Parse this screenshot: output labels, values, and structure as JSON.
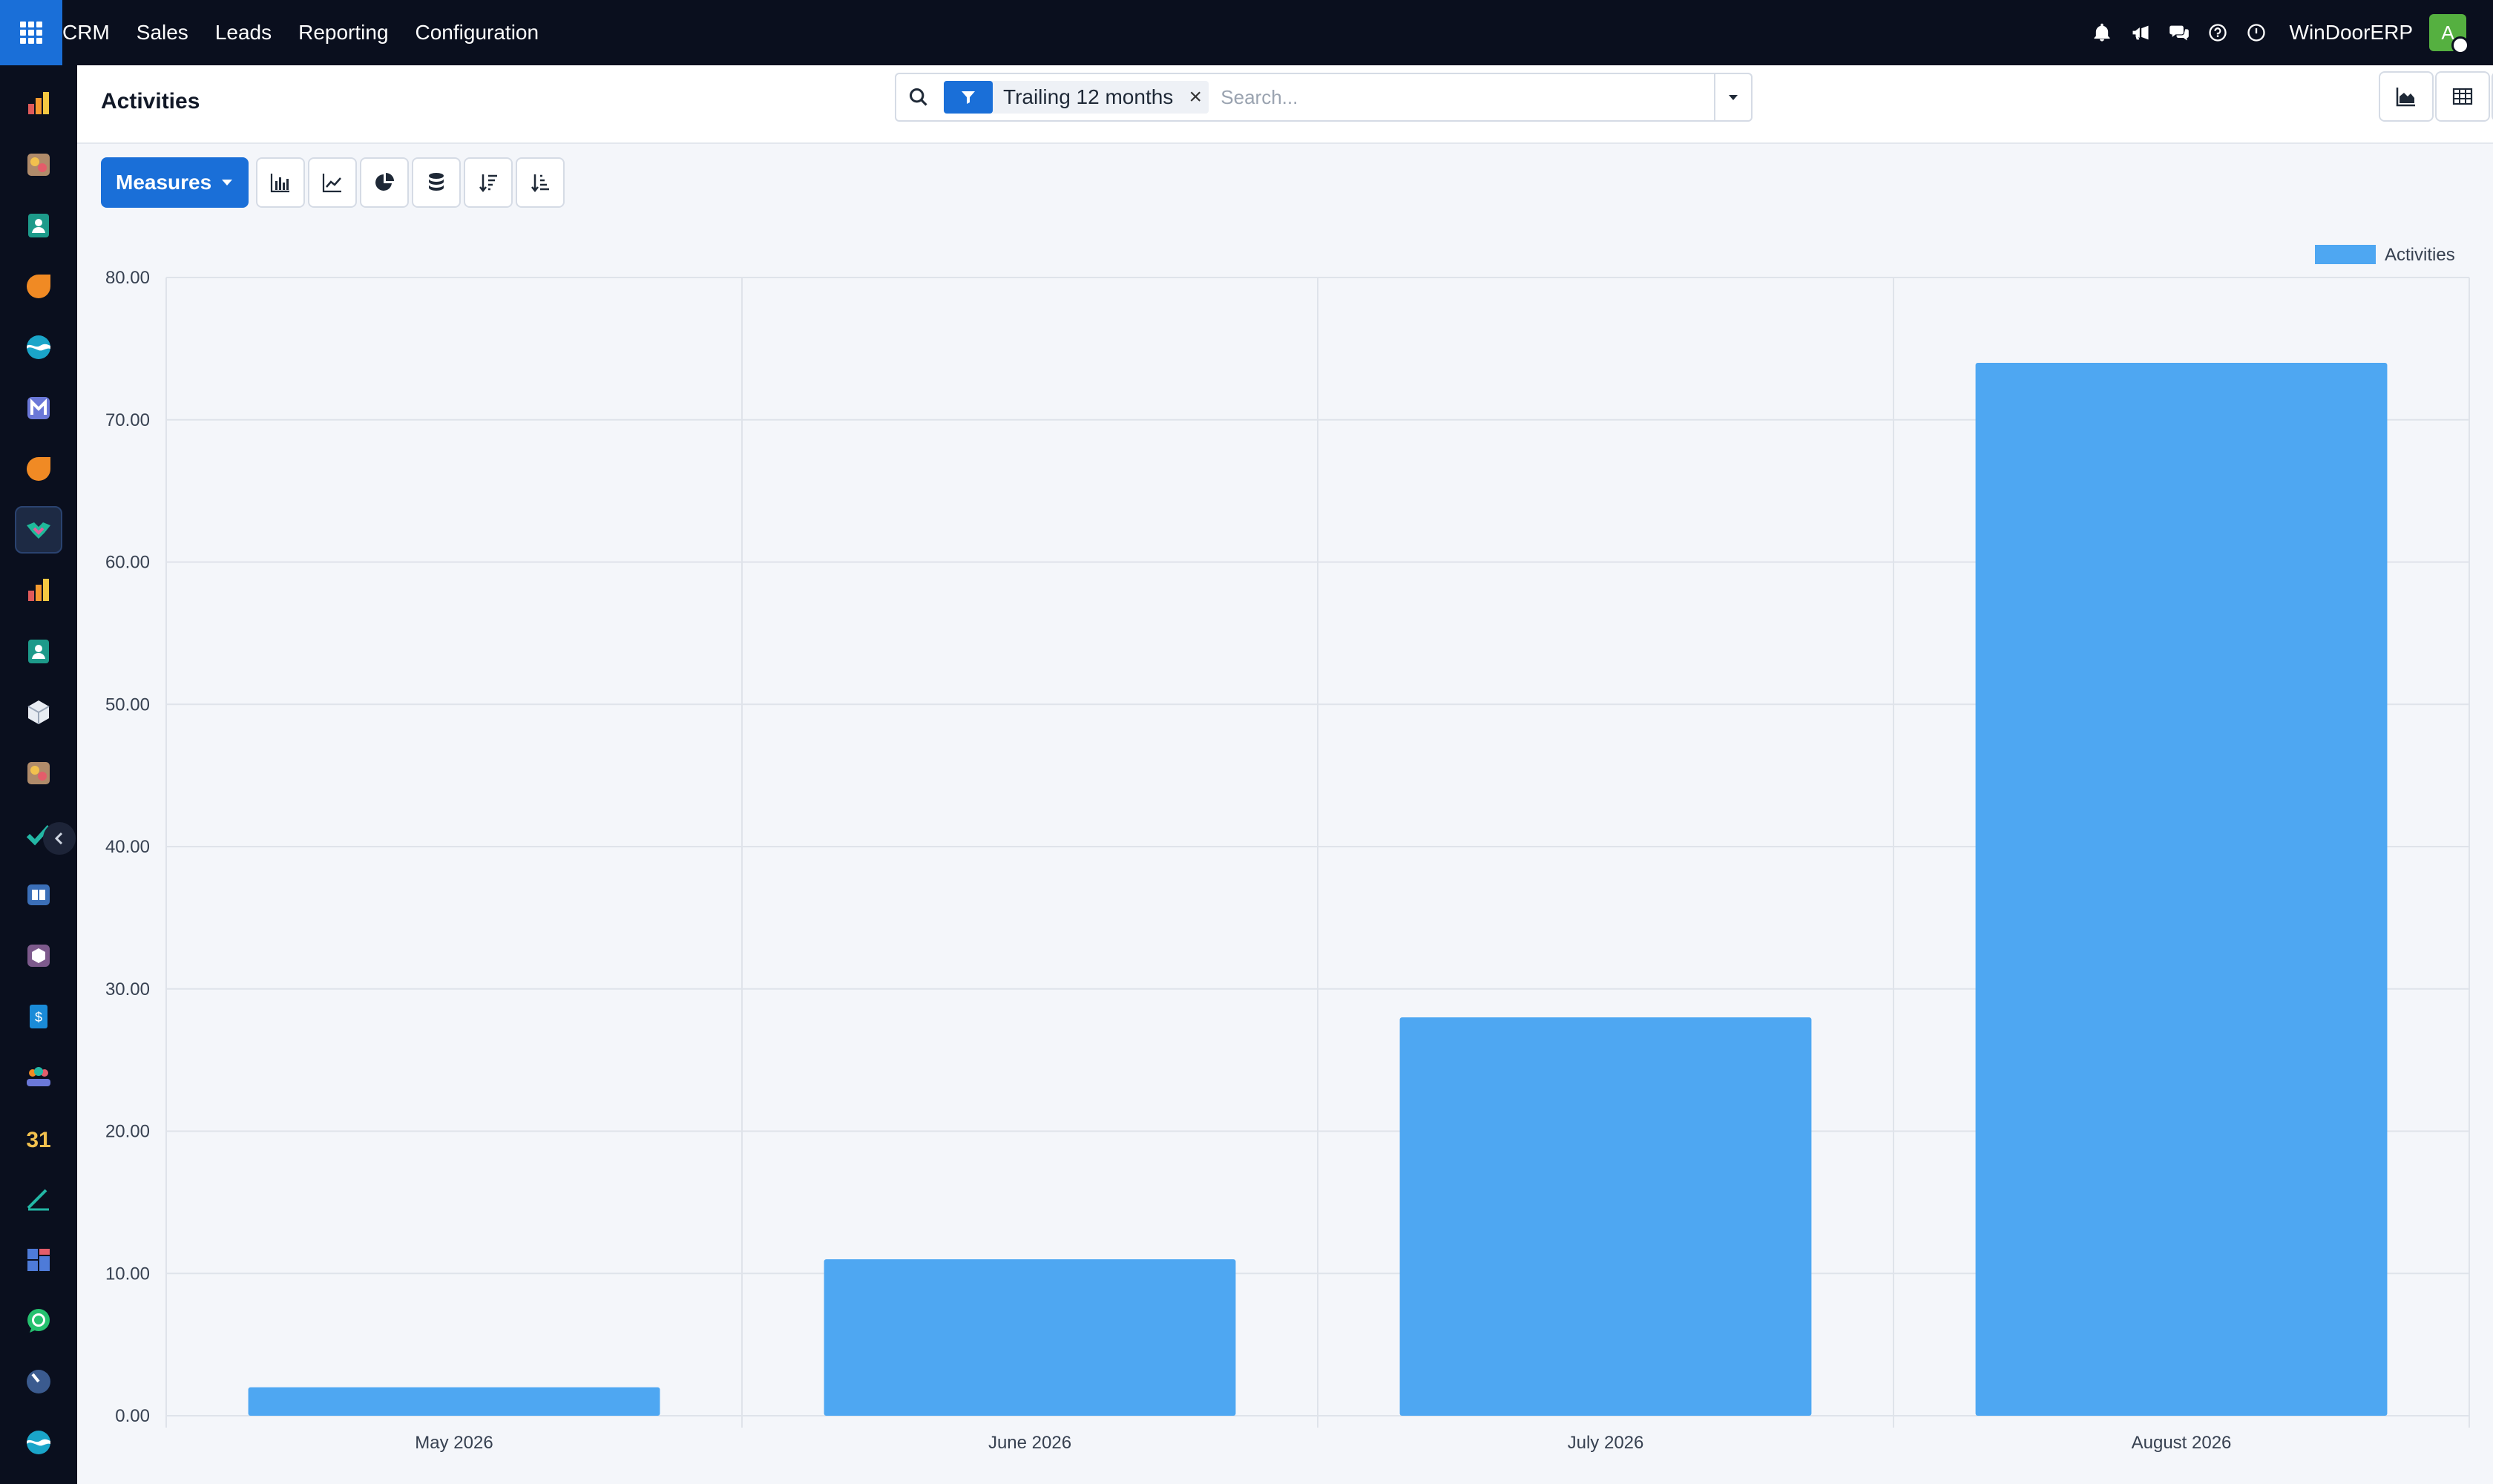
{
  "navbar": {
    "app_name": "CRM",
    "menu": [
      "Sales",
      "Leads",
      "Reporting",
      "Configuration"
    ],
    "company": "WinDoorERP",
    "avatar_letter": "A"
  },
  "control_panel": {
    "title": "Activities",
    "facet_label": "Trailing 12 months",
    "search_placeholder": "Search..."
  },
  "toolbar": {
    "measures_label": "Measures"
  },
  "colors": {
    "accent": "#1a6fd8",
    "bar": "#4ea7f2",
    "navbar": "#0a0f1e"
  },
  "chart_data": {
    "type": "bar",
    "categories": [
      "May 2026",
      "June 2026",
      "July 2026",
      "August 2026"
    ],
    "series": [
      {
        "name": "Activities",
        "values": [
          2,
          11,
          28,
          74
        ]
      }
    ],
    "ylim": [
      0,
      80
    ],
    "yticks": [
      "0.00",
      "10.00",
      "20.00",
      "30.00",
      "40.00",
      "50.00",
      "60.00",
      "70.00",
      "80.00"
    ],
    "grid": true,
    "legend": "top-right"
  }
}
